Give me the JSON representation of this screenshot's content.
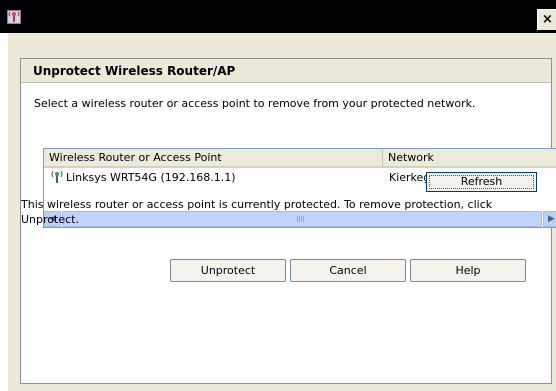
{
  "window": {
    "icon": "wireless-router-icon",
    "close_label": "×"
  },
  "panel": {
    "title": "Unprotect Wireless Router/AP",
    "instruction": "Select a wireless router or access point to remove from your protected network."
  },
  "list": {
    "columns": [
      "Wireless Router or Access Point",
      "Network"
    ],
    "rows": [
      {
        "device": "Linksys WRT54G  (192.168.1.1)",
        "network": "Kierkegaard_4",
        "icon": "router-icon"
      }
    ]
  },
  "scrollbar": {
    "left_arrow": "◀",
    "right_arrow": "▶"
  },
  "buttons": {
    "refresh": "Refresh",
    "unprotect": "Unprotect",
    "cancel": "Cancel",
    "help": "Help"
  },
  "status_text": "This wireless router or access point is currently protected.  To remove protection, click Unprotect.",
  "colors": {
    "dialog_bg": "#ece9d8",
    "list_border": "#7f9db9",
    "scroll_blue": "#c1d3fb"
  }
}
